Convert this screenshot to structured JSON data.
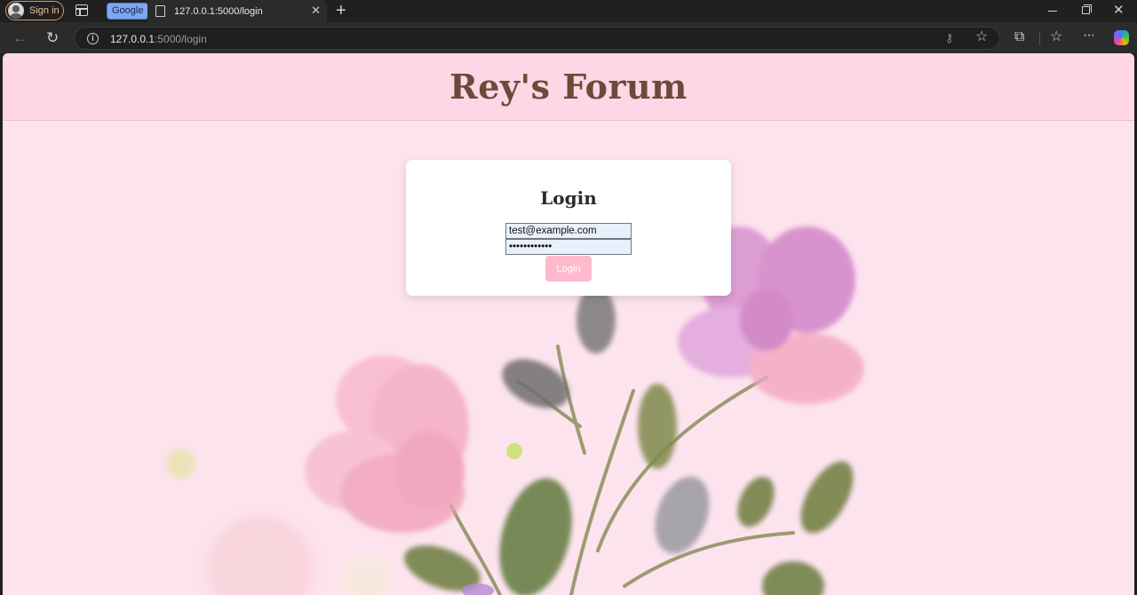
{
  "browser": {
    "signin_label": "Sign in",
    "pinned_tab_label": "Google",
    "active_tab_title": "127.0.0.1:5000/login",
    "url_host": "127.0.0.1",
    "url_path": ":5000/login"
  },
  "site": {
    "title": "Rey's Forum"
  },
  "login": {
    "heading": "Login",
    "email_value": "test@example.com",
    "password_value": "••••••••••••",
    "button_label": "Login"
  },
  "icons": {
    "back": "arrow-left",
    "reload": "circular-arrow",
    "info": "info-circle",
    "key": "key",
    "star": "star",
    "extensions": "puzzle-piece",
    "favorites": "star-list",
    "more": "ellipsis",
    "copilot": "copilot"
  }
}
